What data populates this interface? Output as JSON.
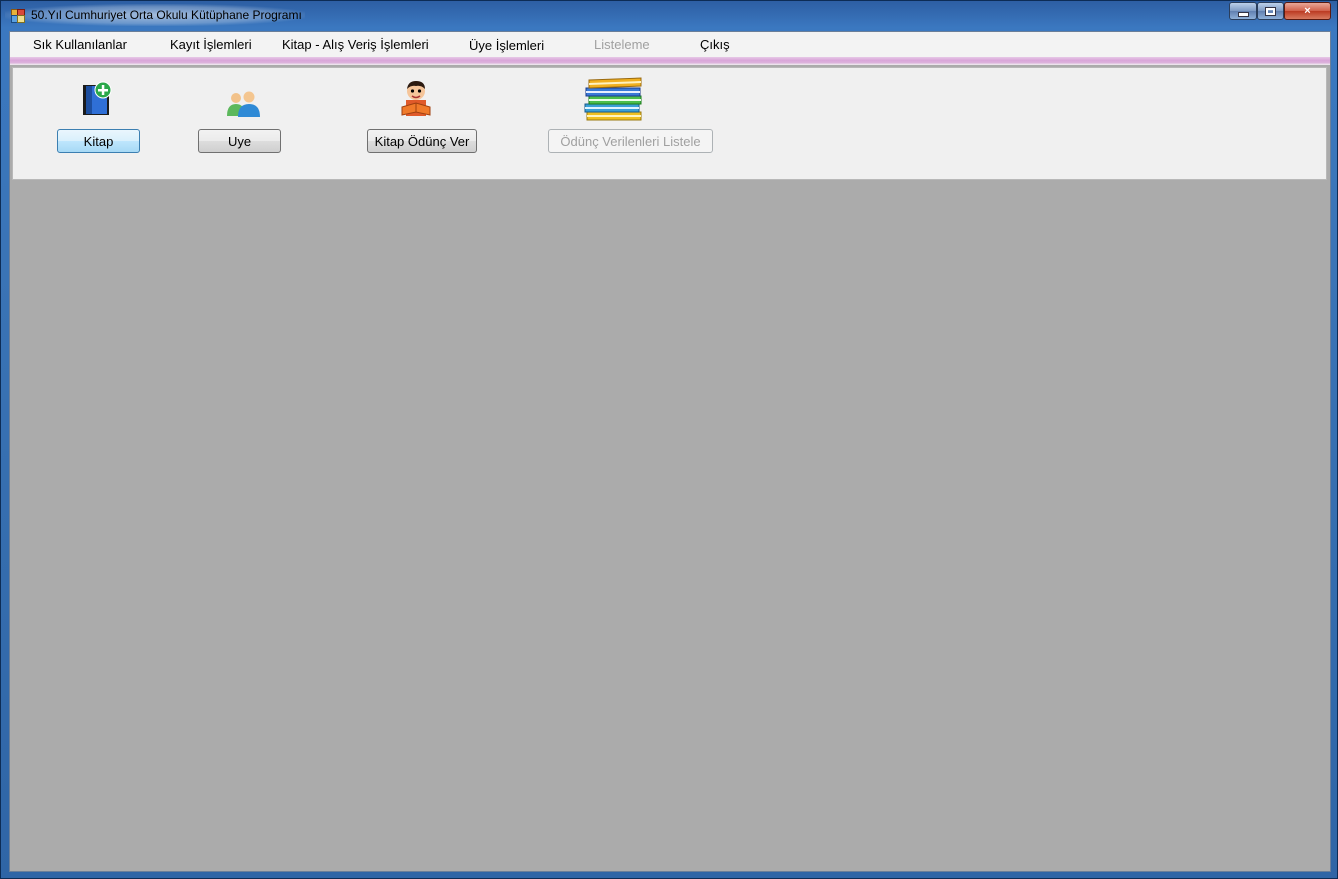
{
  "window": {
    "title": "50.Yıl Cumhuriyet Orta Okulu Kütüphane Programı",
    "app_icon": "app-form-icon",
    "controls": {
      "minimize": "minimize-icon",
      "maximize": "maximize-icon",
      "close": "×"
    }
  },
  "menu": {
    "items": [
      {
        "label": "Sık Kullanılanlar",
        "enabled": true
      },
      {
        "label": "Kayıt İşlemleri",
        "enabled": true
      },
      {
        "label": "Kitap - Alış Veriş İşlemleri",
        "enabled": true
      },
      {
        "label": "Üye İşlemleri",
        "enabled": true
      },
      {
        "label": "Listeleme",
        "enabled": false
      },
      {
        "label": "Çıkış",
        "enabled": true
      }
    ]
  },
  "toolbar": {
    "buttons": [
      {
        "label": "Kitap",
        "icon": "add-book-icon",
        "enabled": true,
        "focused": true
      },
      {
        "label": "Uye",
        "icon": "users-icon",
        "enabled": true,
        "focused": false
      },
      {
        "label": "Kitap Ödünç Ver",
        "icon": "reader-boy-icon",
        "enabled": true,
        "focused": false
      },
      {
        "label": "Ödünç Verilenleri Listele",
        "icon": "book-stack-icon",
        "enabled": false,
        "focused": false
      }
    ]
  },
  "colors": {
    "title_bar": "#3a74b6",
    "menu_strip_accent": "#d9a6d9",
    "mdi_background": "#ababab",
    "panel_background": "#f0f0f0"
  }
}
